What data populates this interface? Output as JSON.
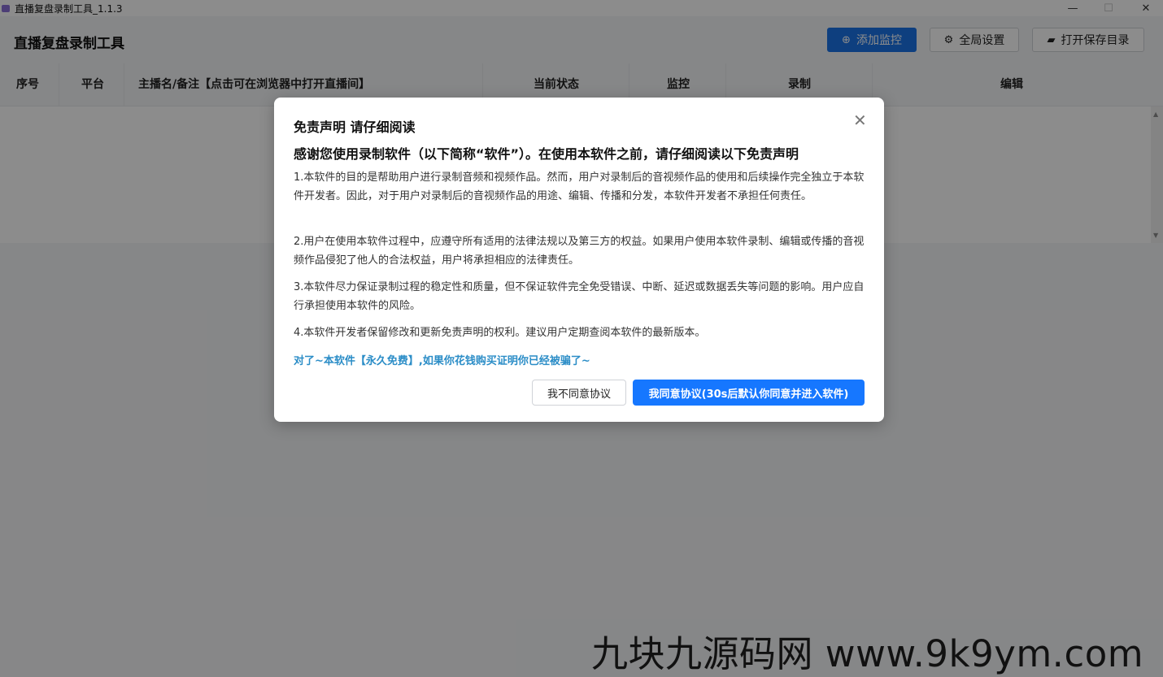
{
  "window": {
    "title": "直播复盘录制工具_1.1.3",
    "controls": {
      "minimize": "—",
      "maximize": "☐",
      "close": "✕"
    }
  },
  "header": {
    "app_title": "直播复盘录制工具",
    "buttons": [
      {
        "label": "添加监控",
        "icon": "plus-circle-icon",
        "glyph": "⊕"
      },
      {
        "label": "全局设置",
        "icon": "settings-sliders-icon",
        "glyph": "⚙"
      },
      {
        "label": "打开保存目录",
        "icon": "folder-open-icon",
        "glyph": "▰"
      }
    ]
  },
  "table": {
    "columns": [
      "序号",
      "平台",
      "主播名/备注【点击可在浏览器中打开直播间】",
      "当前状态",
      "监控",
      "录制",
      "编辑"
    ]
  },
  "dialog": {
    "title": "免责声明 请仔细阅读",
    "subtitle": "感谢您使用录制软件（以下简称“软件”）。在使用本软件之前，请仔细阅读以下免责声明",
    "paragraphs": [
      "1.本软件的目的是帮助用户进行录制音频和视频作品。然而，用户对录制后的音视频作品的使用和后续操作完全独立于本软件开发者。因此，对于用户对录制后的音视频作品的用途、编辑、传播和分发，本软件开发者不承担任何责任。",
      "2.用户在使用本软件过程中，应遵守所有适用的法律法规以及第三方的权益。如果用户使用本软件录制、编辑或传播的音视频作品侵犯了他人的合法权益，用户将承担相应的法律责任。",
      "3.本软件尽力保证录制过程的稳定性和质量，但不保证软件完全免受错误、中断、延迟或数据丢失等问题的影响。用户应自行承担使用本软件的风险。",
      "4.本软件开发者保留修改和更新免责声明的权利。建议用户定期查阅本软件的最新版本。"
    ],
    "note": "对了~本软件【永久免费】,如果你花钱购买证明你已经被骗了~",
    "cancel_label": "我不同意协议",
    "ok_label": "我同意协议(30s后默认你同意并进入软件)",
    "close_glyph": "✕"
  },
  "watermark": "九块九源码网 www.9k9ym.com",
  "colors": {
    "primary": "#1a73e8",
    "note": "#2b8dc7",
    "ok_button": "#1677ff"
  }
}
